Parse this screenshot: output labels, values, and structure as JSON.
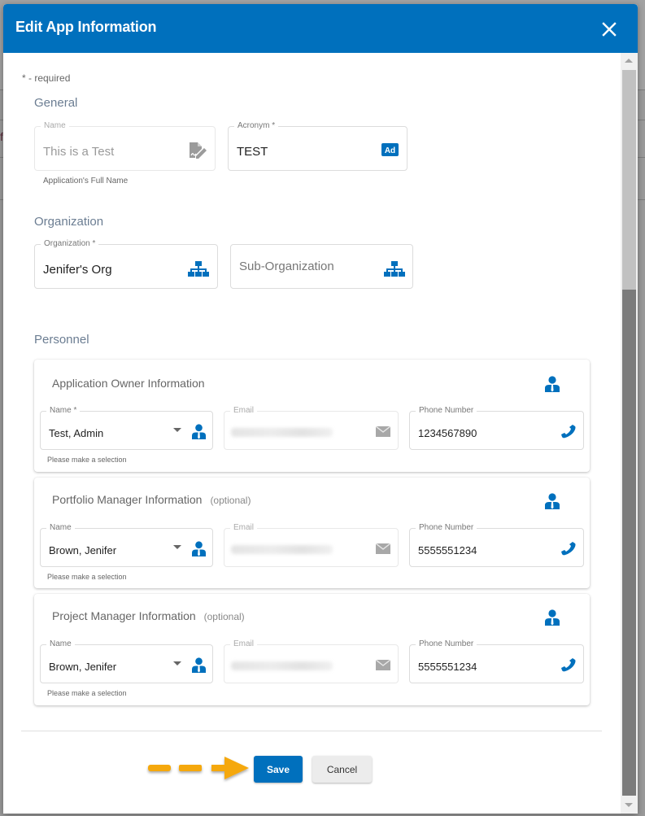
{
  "dialog": {
    "title": "Edit App Information",
    "close_icon": "close-icon",
    "required_note": "* - required"
  },
  "general": {
    "section_title": "General",
    "name": {
      "label": "Name",
      "value": "This is a Test",
      "hint": "Application's Full Name",
      "icon": "signature-icon",
      "disabled": true
    },
    "acronym": {
      "label": "Acronym *",
      "value": "TEST",
      "icon": "ad-badge-icon"
    }
  },
  "organization": {
    "section_title": "Organization",
    "org": {
      "label": "Organization *",
      "value": "Jenifer's Org",
      "icon": "sitemap-icon"
    },
    "sub_org": {
      "placeholder": "Sub-Organization",
      "icon": "sitemap-icon"
    }
  },
  "personnel": {
    "section_title": "Personnel",
    "cards": [
      {
        "title": "Application Owner Information",
        "optional": "",
        "name_label": "Name *",
        "name_value": "Test, Admin",
        "name_hint": "Please make a selection",
        "email_label": "Email",
        "phone_label": "Phone Number",
        "phone_value": "1234567890"
      },
      {
        "title": "Portfolio Manager Information",
        "optional": "(optional)",
        "name_label": "Name",
        "name_value": "Brown, Jenifer",
        "name_hint": "Please make a selection",
        "email_label": "Email",
        "phone_label": "Phone Number",
        "phone_value": "5555551234"
      },
      {
        "title": "Project Manager Information",
        "optional": "(optional)",
        "name_label": "Name",
        "name_value": "Brown, Jenifer",
        "name_hint": "Please make a selection",
        "email_label": "Email",
        "phone_label": "Phone Number",
        "phone_value": "5555551234"
      }
    ]
  },
  "footer": {
    "save_label": "Save",
    "cancel_label": "Cancel"
  },
  "colors": {
    "primary": "#0070bd",
    "annotation_arrow": "#f5a80a",
    "section_title": "#6b7d92"
  }
}
